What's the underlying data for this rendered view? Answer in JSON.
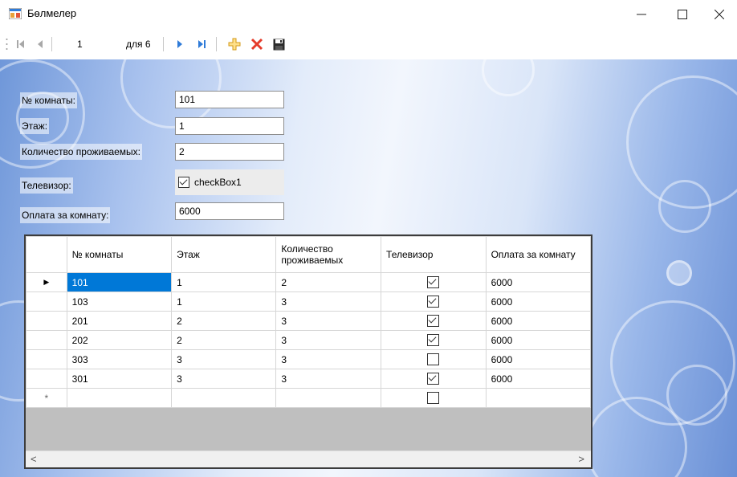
{
  "window": {
    "title": "Бөлмелер",
    "minimize": "—",
    "maximize": "☐",
    "close": "✕"
  },
  "navigator": {
    "position": "1",
    "count_label": "для 6"
  },
  "form": {
    "room_label": "№ комнаты:",
    "room_value": "101",
    "floor_label": "Этаж:",
    "floor_value": "1",
    "residents_label": "Количество проживаемых:",
    "residents_value": "2",
    "tv_label": "Телевизор:",
    "tv_checkbox_text": "checkBox1",
    "tv_checked": true,
    "payment_label": "Оплата за комнату:",
    "payment_value": "6000"
  },
  "grid": {
    "columns": [
      "№ комнаты",
      "Этаж",
      "Количество проживаемых",
      "Телевизор",
      "Оплата за комнату"
    ],
    "rows": [
      {
        "room": "101",
        "floor": "1",
        "residents": "2",
        "tv": true,
        "payment": "6000"
      },
      {
        "room": "103",
        "floor": "1",
        "residents": "3",
        "tv": true,
        "payment": "6000"
      },
      {
        "room": "201",
        "floor": "2",
        "residents": "3",
        "tv": true,
        "payment": "6000"
      },
      {
        "room": "202",
        "floor": "2",
        "residents": "3",
        "tv": true,
        "payment": "6000"
      },
      {
        "room": "303",
        "floor": "3",
        "residents": "3",
        "tv": false,
        "payment": "6000"
      },
      {
        "room": "301",
        "floor": "3",
        "residents": "3",
        "tv": true,
        "payment": "6000"
      }
    ],
    "new_row_marker": "*",
    "current_row_marker": "▶"
  },
  "colors": {
    "selection": "#0078d7",
    "background_accent": "#6f97d9"
  }
}
